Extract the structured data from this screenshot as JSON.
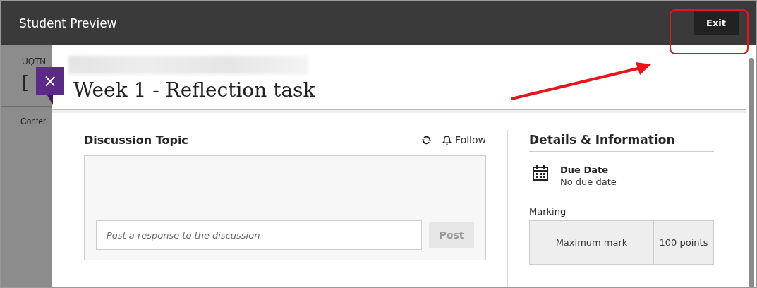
{
  "top_bar": {
    "title": "Student Preview",
    "exit_button": "Exit"
  },
  "background_page": {
    "course_code": "UQTN",
    "course_title": "[",
    "tab": "Conter"
  },
  "panel": {
    "close_icon": "×",
    "title": "Week 1 - Reflection task",
    "discussion": {
      "heading": "Discussion Topic",
      "follow": "Follow",
      "response_placeholder": "Post a response to the discussion",
      "post_button": "Post",
      "post_disabled": true
    },
    "details": {
      "heading": "Details & Information",
      "due_label": "Due Date",
      "due_value": "No due date",
      "marking_heading": "Marking",
      "marking_rows": [
        {
          "label": "Maximum mark",
          "value": "100 points"
        }
      ]
    }
  }
}
